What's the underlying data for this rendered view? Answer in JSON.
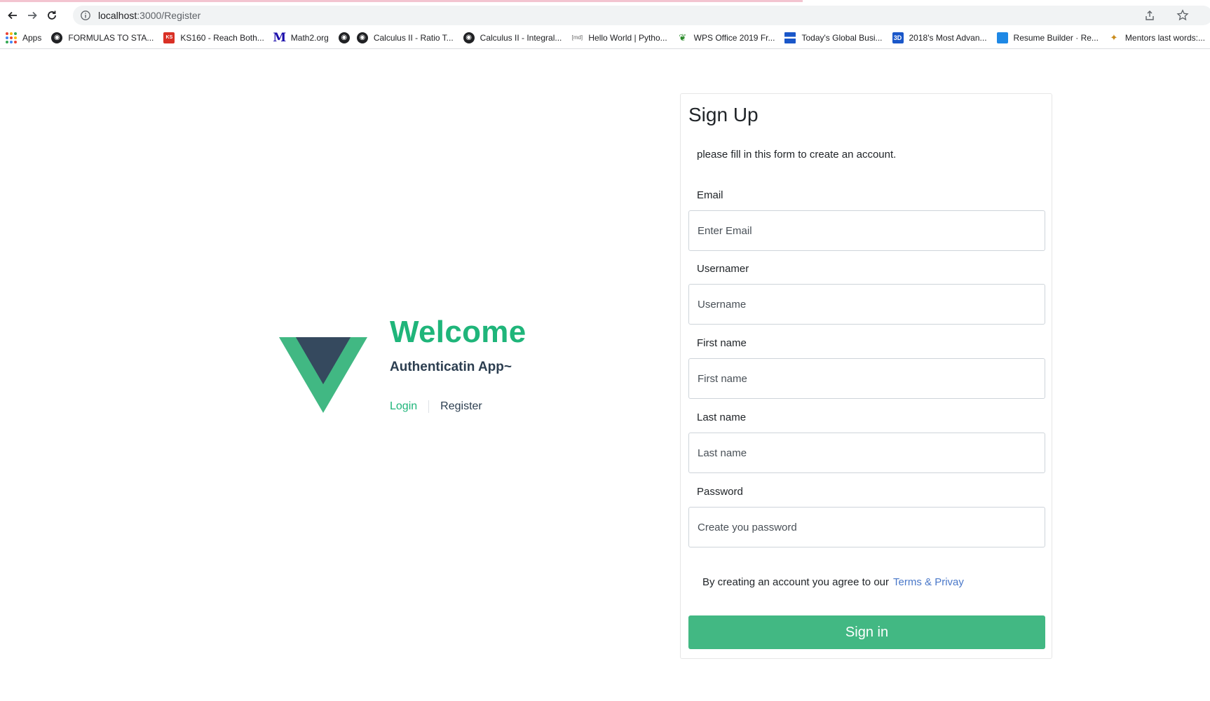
{
  "browser": {
    "url_host": "localhost",
    "url_rest": ":3000/Register",
    "bookmarks": [
      {
        "label": "Apps",
        "icon": "apps-grid-icon"
      },
      {
        "label": "FORMULAS TO STA...",
        "icon": "globe-icon"
      },
      {
        "label": "KS160 - Reach Both...",
        "icon": "ks160-icon"
      },
      {
        "label": "Math2.org",
        "icon": "math2-m-icon"
      },
      {
        "label": "",
        "icon": "globe-icon"
      },
      {
        "label": "Calculus II - Ratio T...",
        "icon": "globe-icon"
      },
      {
        "label": "Calculus II - Integral...",
        "icon": "globe-icon"
      },
      {
        "label": "Hello World | Pytho...",
        "icon": "md-icon"
      },
      {
        "label": "WPS Office 2019 Fr...",
        "icon": "wps-icon"
      },
      {
        "label": "Today's Global Busi...",
        "icon": "flag-icon"
      },
      {
        "label": "2018's Most Advan...",
        "icon": "3d-icon"
      },
      {
        "label": "Resume Builder · Re...",
        "icon": "resume-icon"
      },
      {
        "label": "Mentors last words:...",
        "icon": "mentor-icon"
      }
    ]
  },
  "welcome": {
    "title": "Welcome",
    "subtitle": "Authenticatin App~",
    "nav_login": "Login",
    "nav_register": "Register"
  },
  "form": {
    "title": "Sign Up",
    "description": "please fill in this form to create an account.",
    "email_label": "Email",
    "email_placeholder": "Enter Email",
    "username_label": "Usernamer",
    "username_placeholder": "Username",
    "firstname_label": "First name",
    "firstname_placeholder": "First name",
    "lastname_label": "Last name",
    "lastname_placeholder": "Last name",
    "password_label": "Password",
    "password_placeholder": "Create you password",
    "terms_text": "By creating an account you agree to our",
    "terms_link": "Terms & Privay",
    "submit_label": "Sign in"
  },
  "colors": {
    "accent_green": "#1fb57a",
    "button_green": "#42b883",
    "vue_dark": "#35495e",
    "link_blue": "#4a78c9"
  }
}
